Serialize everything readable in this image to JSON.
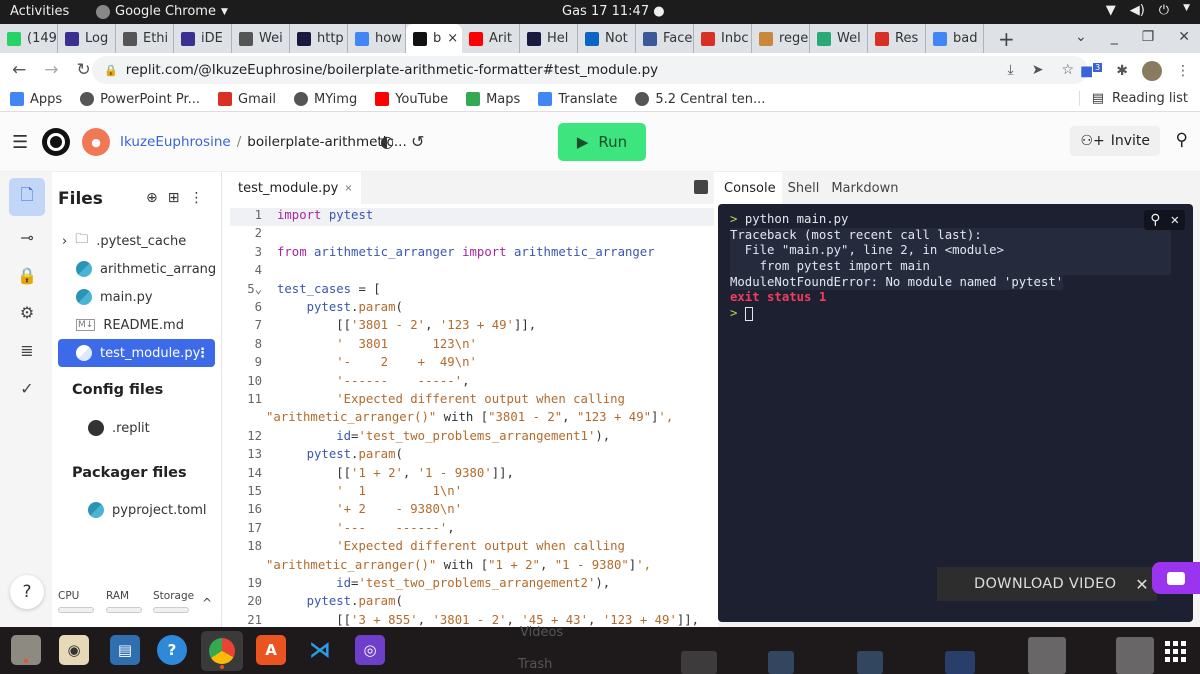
{
  "system_bar": {
    "activities": "Activities",
    "app_name": "Google Chrome",
    "clock": "Gas 17  11:47",
    "indicator": "●"
  },
  "browser_tabs": [
    {
      "icon": "whatsapp-icon",
      "label": "(149",
      "color": "#25d366"
    },
    {
      "icon": "info-icon",
      "label": "Log",
      "color": "#3b2f8f"
    },
    {
      "icon": "globe-icon",
      "label": "Ethi",
      "color": "#555555"
    },
    {
      "icon": "info-icon",
      "label": "iDE",
      "color": "#3b2f8f"
    },
    {
      "icon": "globe-icon",
      "label": "Wei",
      "color": "#555555"
    },
    {
      "icon": "codeacademy-icon",
      "label": "http",
      "color": "#1a1a40"
    },
    {
      "icon": "google-icon",
      "label": "how",
      "color": "#4285f4"
    },
    {
      "icon": "replit-icon",
      "label": "b",
      "color": "#111111",
      "active": true
    },
    {
      "icon": "youtube-icon",
      "label": "Arit",
      "color": "#ff0000"
    },
    {
      "icon": "codeacademy-icon",
      "label": "Hel",
      "color": "#1a1a40"
    },
    {
      "icon": "linkedin-icon",
      "label": "Not",
      "color": "#0a66c2"
    },
    {
      "icon": "facebook-icon",
      "label": "Face",
      "color": "#3b5998"
    },
    {
      "icon": "gmail-icon",
      "label": "Inbc",
      "color": "#d93025"
    },
    {
      "icon": "regex-icon",
      "label": "rege",
      "color": "#c9883a"
    },
    {
      "icon": "fi-icon",
      "label": "Wel",
      "color": "#2aa876"
    },
    {
      "icon": "gmail-icon",
      "label": "Res",
      "color": "#d93025"
    },
    {
      "icon": "google-icon",
      "label": "bad",
      "color": "#4285f4"
    }
  ],
  "browser": {
    "new_tab": "+",
    "url": "replit.com/@IkuzeEuphrosine/boilerplate-arithmetic-formatter#test_module.py",
    "extension_badge": "3",
    "bookmarks": [
      {
        "icon": "apps-grid-icon",
        "label": "Apps"
      },
      {
        "icon": "globe-icon",
        "label": "PowerPoint Pr..."
      },
      {
        "icon": "gmail-icon",
        "label": "Gmail"
      },
      {
        "icon": "globe-icon",
        "label": "MYimg"
      },
      {
        "icon": "youtube-icon",
        "label": "YouTube"
      },
      {
        "icon": "maps-icon",
        "label": "Maps"
      },
      {
        "icon": "translate-icon",
        "label": "Translate"
      },
      {
        "icon": "globe-icon",
        "label": "5.2 Central ten..."
      }
    ],
    "reading_list": "Reading list"
  },
  "replit_header": {
    "username": "IkuzeEuphrosine",
    "separator": "/",
    "repl_name": "boilerplate-arithmetic...",
    "run_label": "Run",
    "invite_label": "Invite",
    "accent": "#3ce57d"
  },
  "files_panel": {
    "title": "Files",
    "items": [
      {
        "label": ".pytest_cache",
        "type": "folder"
      },
      {
        "label": "arithmetic_arrang...",
        "type": "python"
      },
      {
        "label": "main.py",
        "type": "python"
      },
      {
        "label": "README.md",
        "type": "markdown"
      },
      {
        "label": "test_module.py",
        "type": "python",
        "selected": true
      }
    ],
    "config_title": "Config files",
    "config_items": [
      {
        "label": ".replit"
      }
    ],
    "packager_title": "Packager files",
    "packager_items": [
      {
        "label": "pyproject.toml"
      }
    ],
    "stats": {
      "cpu": "CPU",
      "ram": "RAM",
      "storage": "Storage"
    },
    "help": "?"
  },
  "editor": {
    "tab_label": "test_module.py",
    "tab_close": "×",
    "lines": [
      {
        "n": "1",
        "t": "import pytest"
      },
      {
        "n": "2",
        "t": ""
      },
      {
        "n": "3",
        "t": "from arithmetic_arranger import arithmetic_arranger"
      },
      {
        "n": "4",
        "t": ""
      },
      {
        "n": "5",
        "t": "test_cases = ["
      },
      {
        "n": "6",
        "t": "    pytest.param("
      },
      {
        "n": "7",
        "t": "        [['3801 - 2', '123 + 49']],"
      },
      {
        "n": "8",
        "t": "        '  3801      123\\n'"
      },
      {
        "n": "9",
        "t": "        '-    2    +  49\\n'"
      },
      {
        "n": "10",
        "t": "        '------    -----',"
      },
      {
        "n": "11",
        "t": "        'Expected different output when calling"
      },
      {
        "n": "",
        "t": "\"arithmetic_arranger()\" with [\"3801 - 2\", \"123 + 49\"]',"
      },
      {
        "n": "12",
        "t": "        id='test_two_problems_arrangement1'),"
      },
      {
        "n": "13",
        "t": "    pytest.param("
      },
      {
        "n": "14",
        "t": "        [['1 + 2', '1 - 9380']],"
      },
      {
        "n": "15",
        "t": "        '  1         1\\n'"
      },
      {
        "n": "16",
        "t": "        '+ 2    - 9380\\n'"
      },
      {
        "n": "17",
        "t": "        '---    ------',"
      },
      {
        "n": "18",
        "t": "        'Expected different output when calling"
      },
      {
        "n": "",
        "t": "\"arithmetic_arranger()\" with [\"1 + 2\", \"1 - 9380\"]',"
      },
      {
        "n": "19",
        "t": "        id='test_two_problems_arrangement2'),"
      },
      {
        "n": "20",
        "t": "    pytest.param("
      },
      {
        "n": "21",
        "t": "        [['3 + 855', '3801 - 2', '45 + 43', '123 + 49']],"
      }
    ]
  },
  "console": {
    "tabs": [
      "Console",
      "Shell",
      "Markdown"
    ],
    "command": "python main.py",
    "output": [
      "Traceback (most recent call last):",
      "  File \"main.py\", line 2, in <module>",
      "    from pytest import main",
      "ModuleNotFoundError: No module named 'pytest'"
    ],
    "exit": "exit status 1",
    "prompt": ">",
    "error_color": "#f23d5c"
  },
  "overlay": {
    "download_label": "DOWNLOAD VIDEO",
    "close": "✕"
  },
  "dock": {
    "apps": [
      "files-icon",
      "rhythmbox-icon",
      "libreoffice-impress-icon",
      "help-icon",
      "chrome-icon",
      "software-center-icon",
      "vscode-icon",
      "github-desktop-icon"
    ],
    "ghost_labels": [
      "Videos",
      "Trash"
    ]
  }
}
